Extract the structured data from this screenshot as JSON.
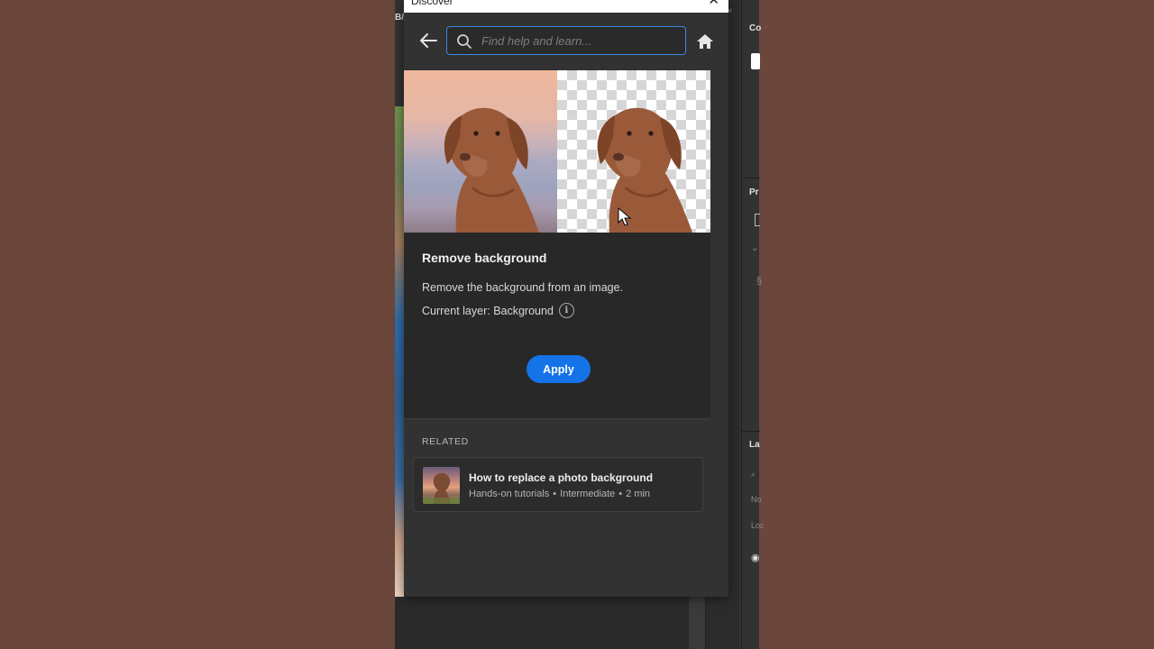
{
  "dialog": {
    "title": "Discover",
    "search_placeholder": "Find help and learn...",
    "search_value": ""
  },
  "feature": {
    "title": "Remove background",
    "description": "Remove the background from an image.",
    "current_layer": "Current layer: Background",
    "apply_label": "Apply"
  },
  "related": {
    "section_label": "RELATED",
    "items": [
      {
        "title": "How to replace a photo background",
        "meta": [
          "Hands-on tutorials",
          "Intermediate",
          "2 min"
        ]
      }
    ]
  },
  "workspace": {
    "left_tab_fragment": "B/",
    "panel_tabs": [
      "Co",
      "Pr",
      "La"
    ],
    "panel_mini": [
      "No",
      "Loc"
    ]
  },
  "colors": {
    "accent": "#1473e6",
    "search_border": "#3b86e3",
    "desktop_bg": "#6a463b"
  },
  "icons": {
    "back": "arrow-left-icon",
    "search": "search-icon",
    "home": "home-icon",
    "close": "close-icon",
    "info": "info-icon"
  }
}
